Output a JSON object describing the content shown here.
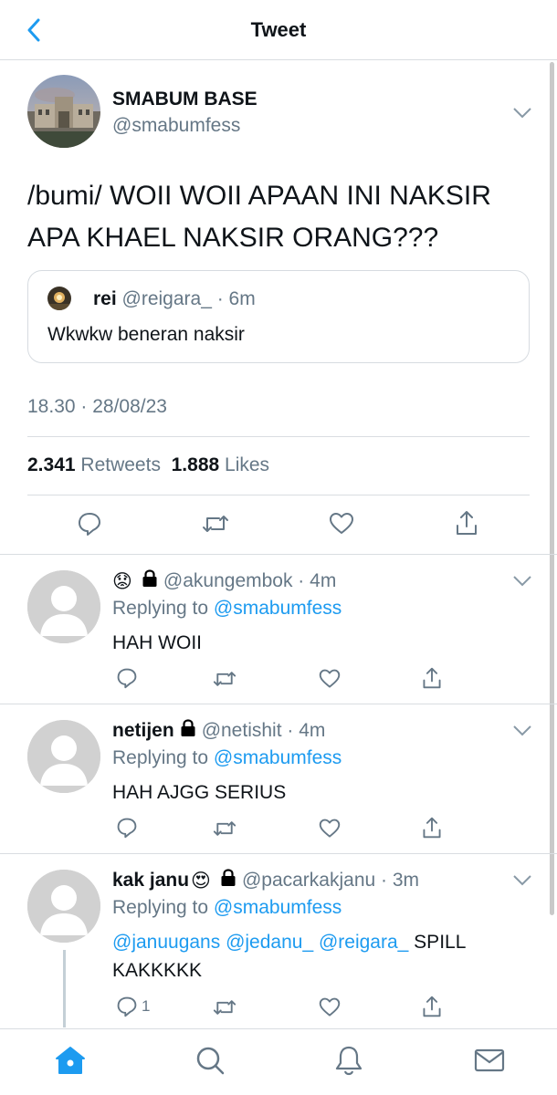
{
  "header": {
    "title": "Tweet"
  },
  "tweet": {
    "author_name": "SMABUM BASE",
    "author_handle": "@smabumfess",
    "text_line1": "/bumi/ WOII WOII APAAN INI NAKSIR",
    "text_line2": "APA KHAEL NAKSIR ORANG???",
    "quote": {
      "name": "rei",
      "handle_time": "@reigara_ · 6m",
      "text": "Wkwkw beneran naksir"
    },
    "timestamp": "18.30 · 28/08/23",
    "retweets_count": "2.341",
    "retweets_label": "Retweets",
    "likes_count": "1.888",
    "likes_label": "Likes"
  },
  "replies": [
    {
      "name": "",
      "name_emoji": "😟",
      "handle_time": "@akungembok · 4m",
      "replying_prefix": "Replying to",
      "replying_to": "@smabumfess",
      "text": "HAH WOII",
      "reply_count": ""
    },
    {
      "name": "netijen",
      "handle_time": "@netishit · 4m",
      "replying_prefix": "Replying to",
      "replying_to": "@smabumfess",
      "text": "HAH AJGG SERIUS",
      "reply_count": ""
    },
    {
      "name": "kak janu",
      "name_emoji": "😍",
      "handle_time": "@pacarkakjanu · 3m",
      "replying_prefix": "Replying to",
      "replying_to": "@smabumfess",
      "mentions": "@januugans @jedanu_ @reigara_",
      "text_after_mentions": " SPILL",
      "text_line2": "KAKKKKK",
      "reply_count": "1"
    }
  ],
  "icons": {
    "back": "chevron-left-icon",
    "reply": "speech-bubble-icon",
    "retweet": "retweet-icon",
    "like": "heart-icon",
    "share": "share-icon",
    "home": "home-icon",
    "search": "search-icon",
    "notifications": "bell-icon",
    "messages": "envelope-icon"
  },
  "colors": {
    "accent": "#1d9bf0",
    "muted": "#657786",
    "text": "#0f1419",
    "border": "#d9dde1"
  }
}
